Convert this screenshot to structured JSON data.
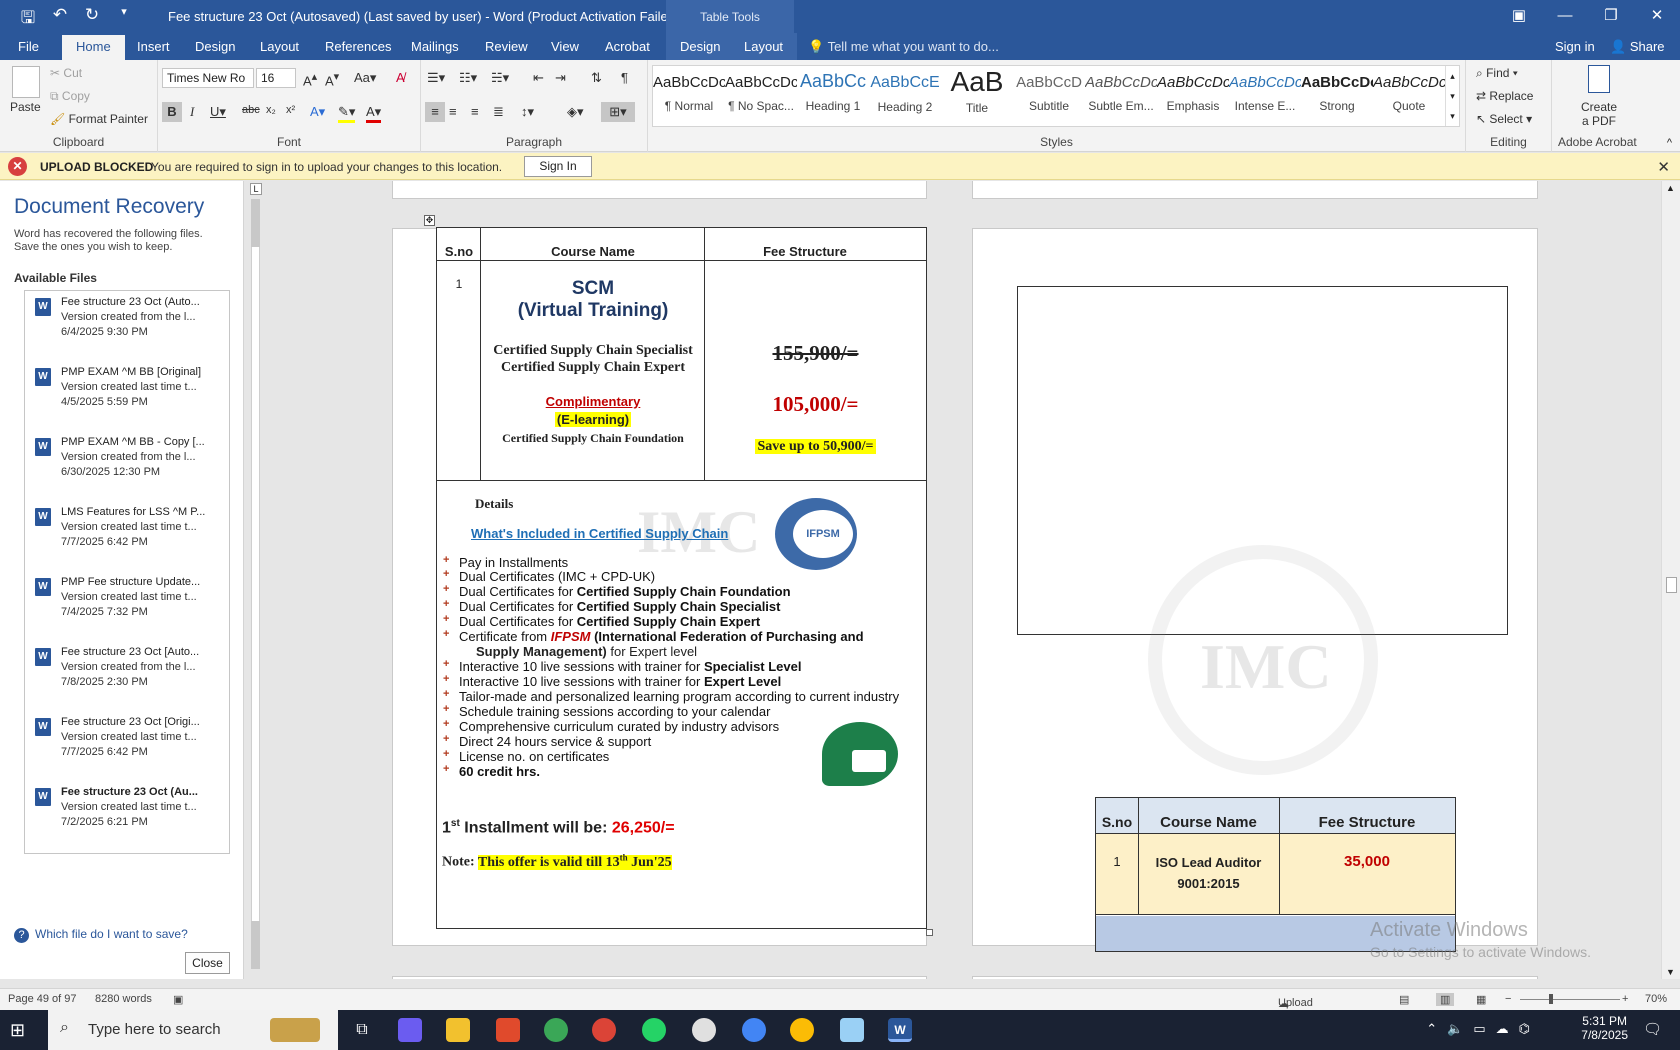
{
  "titlebar": {
    "title": "Fee structure 23 Oct (Autosaved) (Last saved by user) - Word (Product Activation Failed)",
    "context_tab": "Table Tools"
  },
  "tabs": {
    "file": "File",
    "home": "Home",
    "insert": "Insert",
    "design": "Design",
    "layout": "Layout",
    "references": "References",
    "mailings": "Mailings",
    "review": "Review",
    "view": "View",
    "acrobat": "Acrobat",
    "table_design": "Design",
    "table_layout": "Layout",
    "tellme": "Tell me what you want to do...",
    "signin": "Sign in",
    "share": "Share"
  },
  "ribbon": {
    "clipboard": {
      "paste": "Paste",
      "cut": "Cut",
      "copy": "Copy",
      "format_painter": "Format Painter",
      "name": "Clipboard"
    },
    "font": {
      "family": "Times New Ro",
      "size": "16",
      "name": "Font"
    },
    "paragraph": {
      "name": "Paragraph"
    },
    "styles": {
      "name": "Styles",
      "items": [
        {
          "preview": "AaBbCcDc",
          "label": "¶ Normal"
        },
        {
          "preview": "AaBbCcDc",
          "label": "¶ No Spac..."
        },
        {
          "preview": "AaBbCc",
          "label": "Heading 1"
        },
        {
          "preview": "AaBbCcE",
          "label": "Heading 2"
        },
        {
          "preview": "AaB",
          "label": "Title"
        },
        {
          "preview": "AaBbCcD",
          "label": "Subtitle"
        },
        {
          "preview": "AaBbCcDc",
          "label": "Subtle Em..."
        },
        {
          "preview": "AaBbCcDc",
          "label": "Emphasis"
        },
        {
          "preview": "AaBbCcDc",
          "label": "Intense E..."
        },
        {
          "preview": "AaBbCcDc",
          "label": "Strong"
        },
        {
          "preview": "AaBbCcDc",
          "label": "Quote"
        }
      ]
    },
    "editing": {
      "find": "Find",
      "replace": "Replace",
      "select": "Select",
      "name": "Editing"
    },
    "acrobat": {
      "create_line1": "Create",
      "create_line2": "a PDF",
      "name": "Adobe Acrobat"
    }
  },
  "message_bar": {
    "title": "UPLOAD BLOCKED",
    "text": "You are required to sign in to upload your changes to this location.",
    "button": "Sign In"
  },
  "recovery": {
    "heading": "Document Recovery",
    "desc_line1": "Word has recovered the following files.",
    "desc_line2": "Save the ones you wish to keep.",
    "available": "Available Files",
    "files": [
      {
        "name": "Fee structure 23 Oct (Auto...",
        "version": "Version created from the l...",
        "date": "6/4/2025 9:30 PM"
      },
      {
        "name": "PMP EXAM ^M BB  [Original]",
        "version": "Version created last time t...",
        "date": "4/5/2025 5:59 PM"
      },
      {
        "name": "PMP EXAM ^M BB - Copy  [...",
        "version": "Version created from the l...",
        "date": "6/30/2025 12:30 PM"
      },
      {
        "name": "LMS Features for LSS ^M P...",
        "version": "Version created last time t...",
        "date": "7/7/2025 6:42 PM"
      },
      {
        "name": "PMP Fee structure Update... ",
        "version": "Version created last time t...",
        "date": "7/4/2025 7:32 PM"
      },
      {
        "name": "Fee structure 23 Oct  [Auto...",
        "version": "Version created from the l...",
        "date": "7/8/2025 2:30 PM"
      },
      {
        "name": "Fee structure 23 Oct  [Origi...",
        "version": "Version created last time t...",
        "date": "7/7/2025 6:42 PM"
      },
      {
        "name": "Fee structure 23 Oct (Au...",
        "version": "Version created last time t...",
        "date": "7/2/2025 6:21 PM"
      }
    ],
    "which": "Which file do I want to save?",
    "close": "Close"
  },
  "doc": {
    "table": {
      "h_sno": "S.no",
      "h_course": "Course Name",
      "h_fee": "Fee Structure",
      "sno": "1",
      "scm": "SCM",
      "virtual": "(Virtual Training)",
      "c1": "Certified Supply Chain Specialist",
      "c2": "Certified Supply Chain Expert",
      "complimentary": "Complimentary",
      "elearning": "(E-learning)",
      "c3": "Certified Supply Chain Foundation",
      "old_price": "155,900/=",
      "new_price": "105,000/=",
      "save": "Save up to 50,900/=",
      "logo_text": "IFPSM",
      "logo2_text": "IMC"
    },
    "details": {
      "heading": "Details",
      "included": "What's Included in Certified Supply Chain",
      "b1": "Pay in Installments",
      "b2": "Dual Certificates (IMC + CPD-UK)",
      "b3a": "Dual Certificates for ",
      "b3b": "Certified Supply Chain Foundation",
      "b4a": "Dual Certificates for ",
      "b4b": "Certified Supply Chain Specialist",
      "b5a": "Dual Certificates for ",
      "b5b": "Certified Supply Chain Expert",
      "b6a": "Certificate from ",
      "b6b": "IFPSM",
      "b6c": " (International Federation of Purchasing and",
      "b6d": "Supply Management)",
      "b6e": " for Expert level",
      "b7a": "Interactive 10 live sessions with trainer for ",
      "b7b": "Specialist Level",
      "b8a": "Interactive 10 live sessions with trainer for ",
      "b8b": "Expert Level",
      "b9": "Tailor-made and personalized learning program according to current industry",
      "b10": "Schedule training sessions according to your calendar",
      "b11": "Comprehensive curriculum curated by industry advisors",
      "b12": "Direct 24 hours service & support",
      "b13": "License no. on certificates",
      "b14": "60 credit hrs."
    },
    "installment": {
      "pre": "1",
      "sup": "st",
      "text": " Installment will be: ",
      "amount": "26,250/="
    },
    "note": {
      "label": "Note: ",
      "text_a": "This offer is valid till 13",
      "sup": "th",
      "text_b": " Jun'25"
    },
    "iso": {
      "h_sno": "S.no",
      "h_course": "Course Name",
      "h_fee": "Fee Structure",
      "sno": "1",
      "course_l1": "ISO Lead Auditor",
      "course_l2": "9001:2015",
      "fee": "35,000"
    },
    "watermark": "IMC"
  },
  "activate": {
    "line1": "Activate Windows",
    "line2": "Go to Settings to activate Windows."
  },
  "status": {
    "page": "Page 49 of 97",
    "words": "8280 words",
    "upload": "Upload Failed",
    "zoom": "70%"
  },
  "taskbar": {
    "search": "Type here to search",
    "time": "5:31 PM",
    "date": "7/8/2025"
  },
  "colors": {
    "word_blue": "#2b579a",
    "price_red": "#c00000",
    "highlight": "#ffff00",
    "link_blue": "#1f6fb5"
  }
}
